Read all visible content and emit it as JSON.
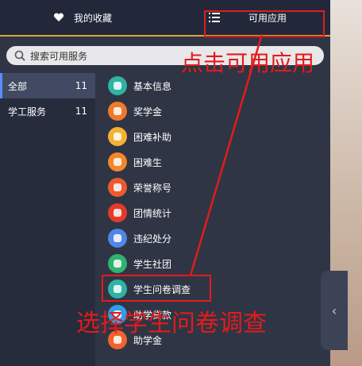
{
  "tabs": {
    "favorites": "我的收藏",
    "available": "可用应用"
  },
  "search": {
    "placeholder": "搜索可用服务"
  },
  "categories": [
    {
      "label": "全部",
      "count": "11"
    },
    {
      "label": "学工服务",
      "count": "11"
    }
  ],
  "apps": [
    {
      "label": "基本信息",
      "icon": "id-card-icon",
      "color": "#2fb3a5"
    },
    {
      "label": "奖学金",
      "icon": "award-icon",
      "color": "#f07a2a"
    },
    {
      "label": "困难补助",
      "icon": "hand-coin-icon",
      "color": "#f3b233"
    },
    {
      "label": "困难生",
      "icon": "heart-hand-icon",
      "color": "#f4872a"
    },
    {
      "label": "荣誉称号",
      "icon": "medal-icon",
      "color": "#ee5a2f"
    },
    {
      "label": "团情统计",
      "icon": "party-emblem-icon",
      "color": "#e33a2b"
    },
    {
      "label": "违纪处分",
      "icon": "scale-icon",
      "color": "#4f86e8"
    },
    {
      "label": "学生社团",
      "icon": "group-icon",
      "color": "#2fb36f"
    },
    {
      "label": "学生问卷调查",
      "icon": "survey-icon",
      "color": "#2fb3a5"
    },
    {
      "label": "助学贷款",
      "icon": "loan-icon",
      "color": "#2f9fe8"
    },
    {
      "label": "助学金",
      "icon": "grant-icon",
      "color": "#f0632f"
    }
  ],
  "annotations": {
    "top": "点击可用应用",
    "bottom": "选择学生问卷调查"
  },
  "colors": {
    "annotation": "#e31b1b",
    "tab_underline": "#d8a437",
    "panel_bg": "#2f3545"
  },
  "side_handle": {
    "glyph": "‹"
  }
}
